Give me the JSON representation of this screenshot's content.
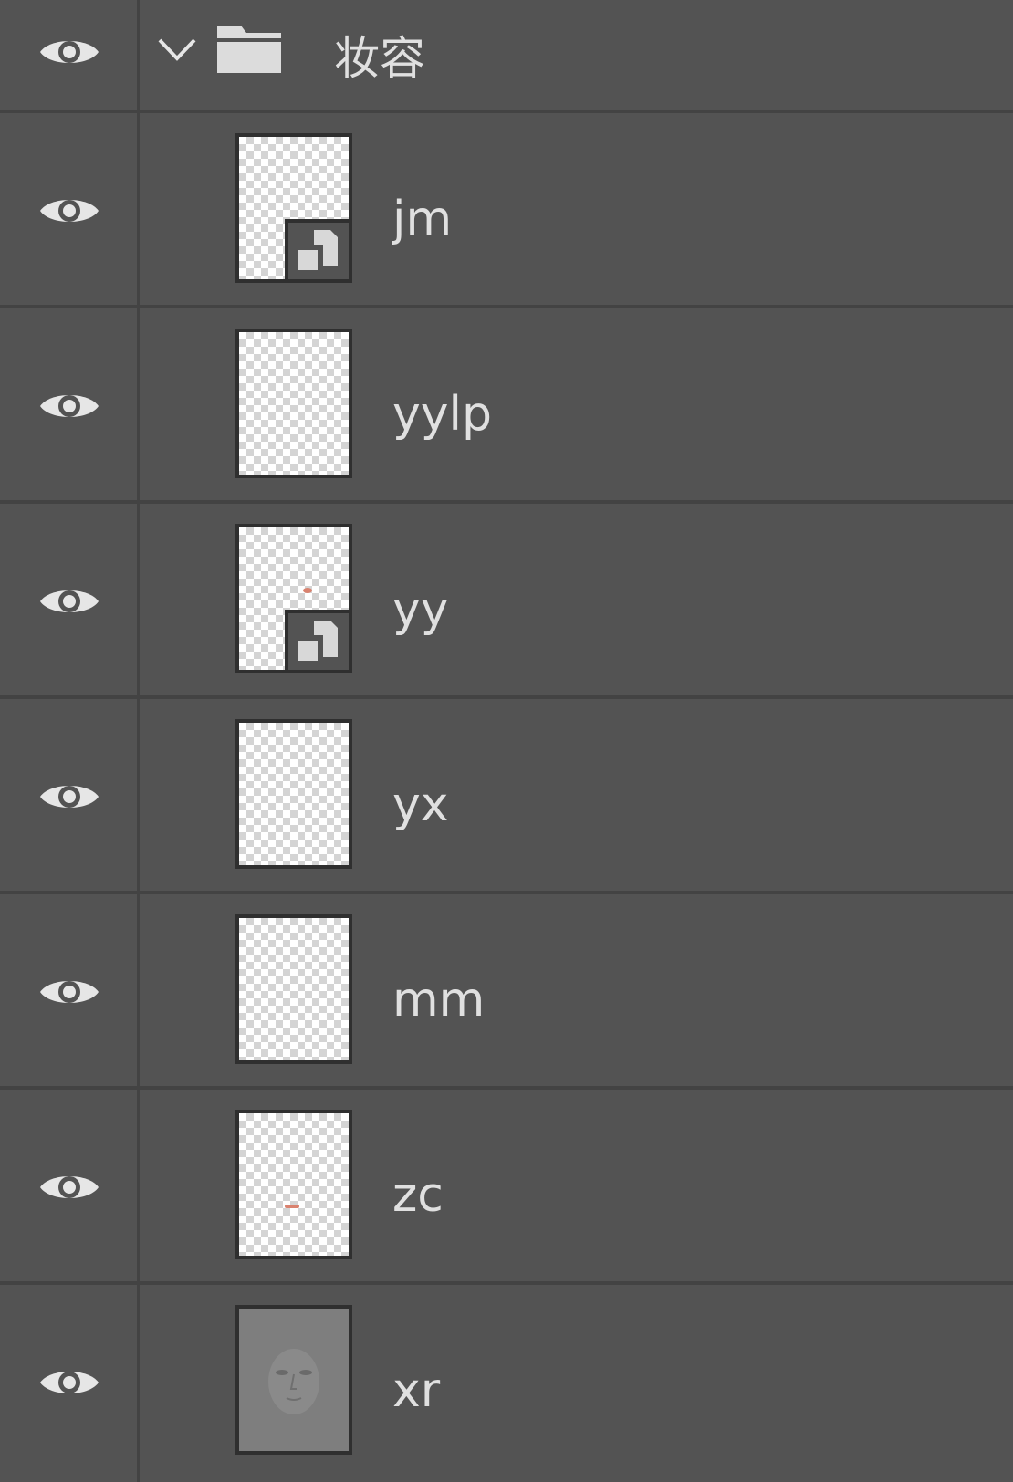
{
  "layers_panel": {
    "group": {
      "name": "妆容",
      "expanded": true,
      "visible": true,
      "icons": {
        "visibility": "eye-icon",
        "disclosure": "chevron-down-icon",
        "folder": "folder-icon"
      }
    },
    "layers": [
      {
        "name": "jm",
        "visible": true,
        "smart_object": true,
        "thumbnail": "transparent"
      },
      {
        "name": "yylp",
        "visible": true,
        "smart_object": false,
        "thumbnail": "transparent"
      },
      {
        "name": "yy",
        "visible": true,
        "smart_object": true,
        "thumbnail": "transparent-with-red-mark"
      },
      {
        "name": "yx",
        "visible": true,
        "smart_object": false,
        "thumbnail": "transparent"
      },
      {
        "name": "mm",
        "visible": true,
        "smart_object": false,
        "thumbnail": "transparent"
      },
      {
        "name": "zc",
        "visible": true,
        "smart_object": false,
        "thumbnail": "transparent-with-red-mark"
      },
      {
        "name": "xr",
        "visible": true,
        "smart_object": false,
        "thumbnail": "gray-face"
      }
    ],
    "colors": {
      "panel_bg": "#535353",
      "divider": "#434343",
      "text": "#e0e0e0",
      "icon": "#e6e6e6"
    }
  }
}
